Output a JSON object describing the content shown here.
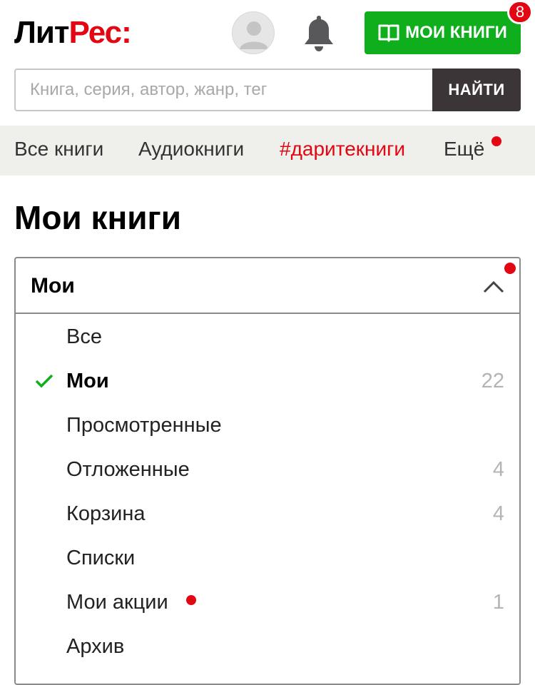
{
  "header": {
    "logo_part1": "Лит",
    "logo_part2": "Рес:",
    "my_books_label": "МОИ КНИГИ",
    "my_books_badge": "8"
  },
  "search": {
    "placeholder": "Книга, серия, автор, жанр, тег",
    "value": "",
    "button_label": "НАЙТИ"
  },
  "nav": {
    "items": [
      {
        "label": "Все книги"
      },
      {
        "label": "Аудиокниги"
      },
      {
        "label": "#даритекниги",
        "highlight": true
      },
      {
        "label": "Ещё",
        "has_dot": true
      }
    ]
  },
  "page": {
    "title": "Мои книги"
  },
  "dropdown": {
    "selected_label": "Мои",
    "has_dot": true,
    "options": [
      {
        "label": "Все",
        "count": ""
      },
      {
        "label": "Мои",
        "count": "22",
        "selected": true
      },
      {
        "label": "Просмотренные",
        "count": ""
      },
      {
        "label": "Отложенные",
        "count": "4"
      },
      {
        "label": "Корзина",
        "count": "4"
      },
      {
        "label": "Списки",
        "count": ""
      },
      {
        "label": "Мои акции",
        "count": "1",
        "has_dot": true
      },
      {
        "label": "Архив",
        "count": ""
      }
    ]
  },
  "colors": {
    "brand_red": "#e30613",
    "green": "#0fae1d",
    "search_button": "#3b3538",
    "nav_background": "#efefeb"
  },
  "icons": {
    "avatar": "user-avatar-icon",
    "bell": "bell-icon",
    "book": "open-book-icon",
    "chevron": "chevron-up-icon",
    "check": "checkmark-icon"
  }
}
